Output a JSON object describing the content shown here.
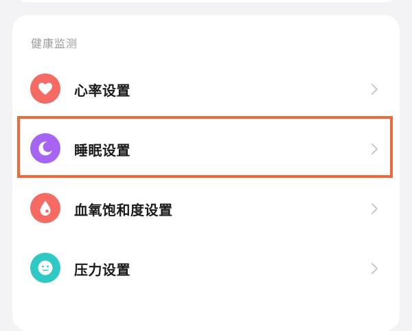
{
  "colors": {
    "heart": "#f56a63",
    "sleep": "#a565f2",
    "oxygen": "#f56a63",
    "stress": "#2ec9c4",
    "highlight": "#ee6a3b"
  },
  "section": {
    "title": "健康监测"
  },
  "items": [
    {
      "label": "心率设置",
      "icon": "heart-icon"
    },
    {
      "label": "睡眠设置",
      "icon": "moon-icon"
    },
    {
      "label": "血氧饱和度设置",
      "icon": "drop-icon"
    },
    {
      "label": "压力设置",
      "icon": "face-icon"
    }
  ]
}
